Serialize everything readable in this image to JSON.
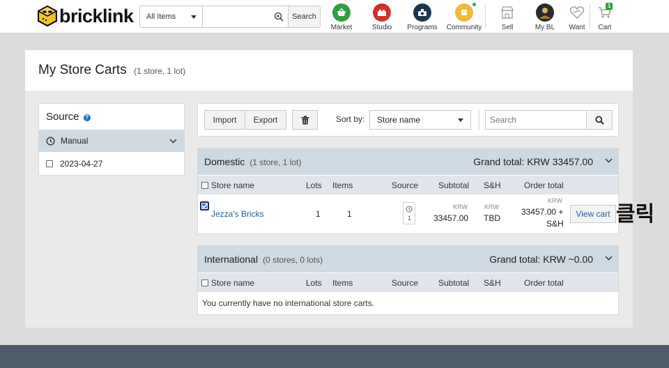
{
  "header": {
    "logo_text": "bricklink",
    "search": {
      "category": "All Items",
      "placeholder": "",
      "button": "Search"
    },
    "nav": {
      "market": "Market",
      "studio": "Studio",
      "programs": "Programs",
      "community": "Community",
      "sell": "Sell",
      "my_bl": "My BL",
      "want": "Want",
      "cart": "Cart",
      "cart_count": "1"
    }
  },
  "page": {
    "title": "My Store Carts",
    "subtitle": "(1 store, 1 lot)"
  },
  "source_panel": {
    "title": "Source",
    "help": "?",
    "manual": "Manual",
    "date": "2023-04-27"
  },
  "toolbar": {
    "import": "Import",
    "export": "Export",
    "sort_label": "Sort by:",
    "sort_value": "Store name",
    "search_placeholder": "Search"
  },
  "columns": {
    "store_name": "Store name",
    "lots": "Lots",
    "items": "Items",
    "source": "Source",
    "subtotal": "Subtotal",
    "sh": "S&H",
    "order_total": "Order total"
  },
  "domestic": {
    "title": "Domestic",
    "subtitle": "(1 store, 1 lot)",
    "grand_total": "Grand total: KRW 33457.00",
    "rows": [
      {
        "store": "Jezza's Bricks",
        "lots": "1",
        "items": "1",
        "source_count": "1",
        "subtotal_currency": "KRW",
        "subtotal": "33457.00",
        "sh_currency": "KRW",
        "sh": "TBD",
        "order_currency": "KRW",
        "order_line1": "33457.00 +",
        "order_line2": "S&H",
        "action": "View cart"
      }
    ]
  },
  "international": {
    "title": "International",
    "subtitle": "(0 stores, 0 lots)",
    "grand_total": "Grand total: KRW ~0.00",
    "empty_message": "You currently have no international store carts."
  },
  "annotation": "클릭",
  "colors": {
    "section_header": "#cfd9e2",
    "column_header": "#dfe5eb",
    "link": "#1f5e96",
    "footer": "#4e5b6a",
    "market": "#2e9e3f",
    "studio": "#d32f2f",
    "programs": "#1d3650",
    "community": "#f0b93a"
  }
}
